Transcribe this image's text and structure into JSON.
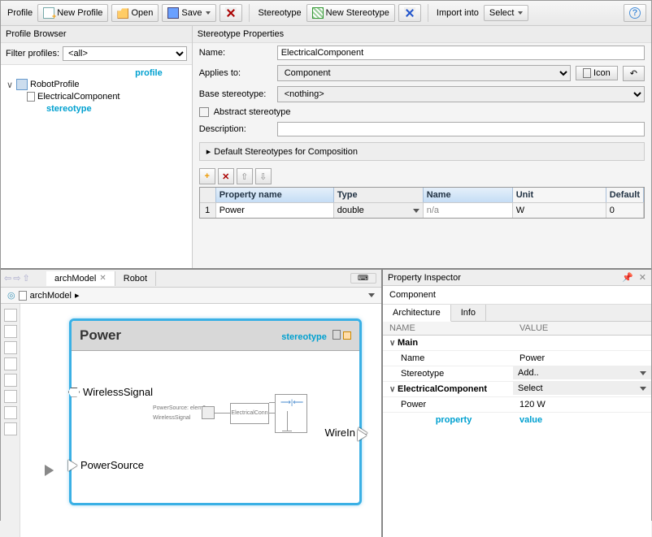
{
  "toolbar": {
    "profile_label": "Profile",
    "new_profile": "New Profile",
    "open": "Open",
    "save": "Save",
    "stereotype_label": "Stereotype",
    "new_stereotype": "New Stereotype",
    "import_label": "Import into",
    "select": "Select"
  },
  "browser": {
    "title": "Profile Browser",
    "filter_label": "Filter profiles:",
    "filter_value": "<all>",
    "tree": {
      "root": "RobotProfile",
      "child": "ElectricalComponent"
    },
    "annot_profile": "profile",
    "annot_stereotype": "stereotype"
  },
  "props": {
    "title": "Stereotype Properties",
    "name_label": "Name:",
    "name_value": "ElectricalComponent",
    "applies_label": "Applies to:",
    "applies_value": "Component",
    "icon_btn": "Icon",
    "base_label": "Base stereotype:",
    "base_value": "<nothing>",
    "abstract_label": "Abstract stereotype",
    "desc_label": "Description:",
    "desc_value": "",
    "collap_label": "Default Stereotypes for Composition",
    "grid": {
      "headers": [
        "",
        "Property name",
        "Type",
        "Name",
        "Unit",
        "Default"
      ],
      "row": {
        "num": "1",
        "pname": "Power",
        "type": "double",
        "name": "n/a",
        "unit": "W",
        "def": "0"
      }
    }
  },
  "editor": {
    "tab1": "archModel",
    "tab2": "Robot",
    "crumb": "archModel",
    "annot_stereotype": "stereotype",
    "comp_title": "Power",
    "ports": {
      "wireless": "WirelessSignal",
      "wirein": "WireIn",
      "powersrc": "PowerSource"
    },
    "inner": {
      "p1": "PowerSource: elem0",
      "p2": "WirelessSignal",
      "b1": "ElectricalConn"
    }
  },
  "inspector": {
    "title": "Property Inspector",
    "component": "Component",
    "tab_arch": "Architecture",
    "tab_info": "Info",
    "col_name": "NAME",
    "col_value": "VALUE",
    "cat_main": "Main",
    "row_name_k": "Name",
    "row_name_v": "Power",
    "row_st_k": "Stereotype",
    "row_st_v": "Add..",
    "cat_ec": "ElectricalComponent",
    "cat_ec_v": "Select",
    "row_pw_k": "Power",
    "row_pw_v": "120 W",
    "annot_prop": "property",
    "annot_val": "value"
  }
}
